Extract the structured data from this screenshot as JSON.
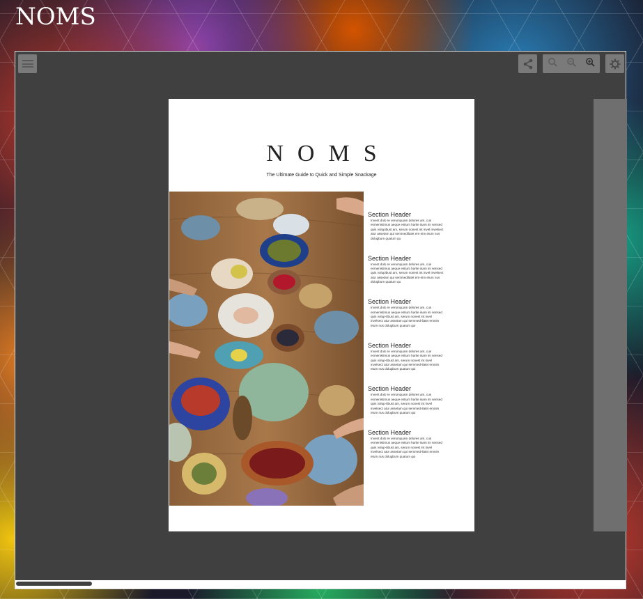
{
  "site": {
    "title": "NOMS"
  },
  "toolbar": {
    "menu_icon": "hamburger-menu-icon",
    "share_icon": "share-icon",
    "zoom_out_icon": "zoom-out-icon",
    "zoom_reset_icon": "zoom-reset-icon",
    "zoom_in_icon": "zoom-in-icon",
    "settings_icon": "gear-icon"
  },
  "page": {
    "title": "NOMS",
    "subtitle": "The Ultimate Guide to Quick and Simple Snackage",
    "sections": [
      {
        "header": "Section Header",
        "body": "Invent dolo re verumquam delores am, cus esmenistimus aeque estium harite isam im sensed quis volupibust am, serum nonest int invel invelsect atur assetam qui semmedilatet em-nim etum nus dolugbum quatum qu"
      },
      {
        "header": "Section Header",
        "body": "Invent dolo re verumquam delores am, cus esmenistimus aeque estium harite isam im sensed quis volupibust am, serum nonest int invel invelsect atur assetam qui semmedilatet em-nim etum nus dolugbum quatum qu"
      },
      {
        "header": "Section Header",
        "body": "Invent dolo re verumquam delores am, cus esmenistimus aeque estium harite isam im sensed quis volup-tibust am, serum nonest int invel invelsect atur assetam qui semmed-ilatet emnim etum nus dolugbum quatum qui"
      },
      {
        "header": "Section Header",
        "body": "Invent dolo re verumquam delores am, cus esmenistimus aeque estium harite isam im sensed quis volup-tibust am, serum nonest int invel invelsect atur assetam qui semmed-ilatet emnim etum nus dolugbum quatum qui"
      },
      {
        "header": "Section Header",
        "body": "Invent dolo re verumquam delores am, cus esmenistimus aeque estium harite isam im sensed quis volup-tibust am, serum nonest int invel invelsect atur assetam qui semmed-ilatet emnim etum nus dolugbum quatum qui"
      },
      {
        "header": "Section Header",
        "body": "Invent dolo re verumquam delores am, cus esmenistimus aeque estium harite isam im sensed quis volup-tibust am, serum nonest int invel invelsect atur assetam qui semmed-ilatet emnim etum nus dolugbum quatum qui"
      }
    ]
  },
  "scroll": {
    "horizontal_position": 0.12
  }
}
